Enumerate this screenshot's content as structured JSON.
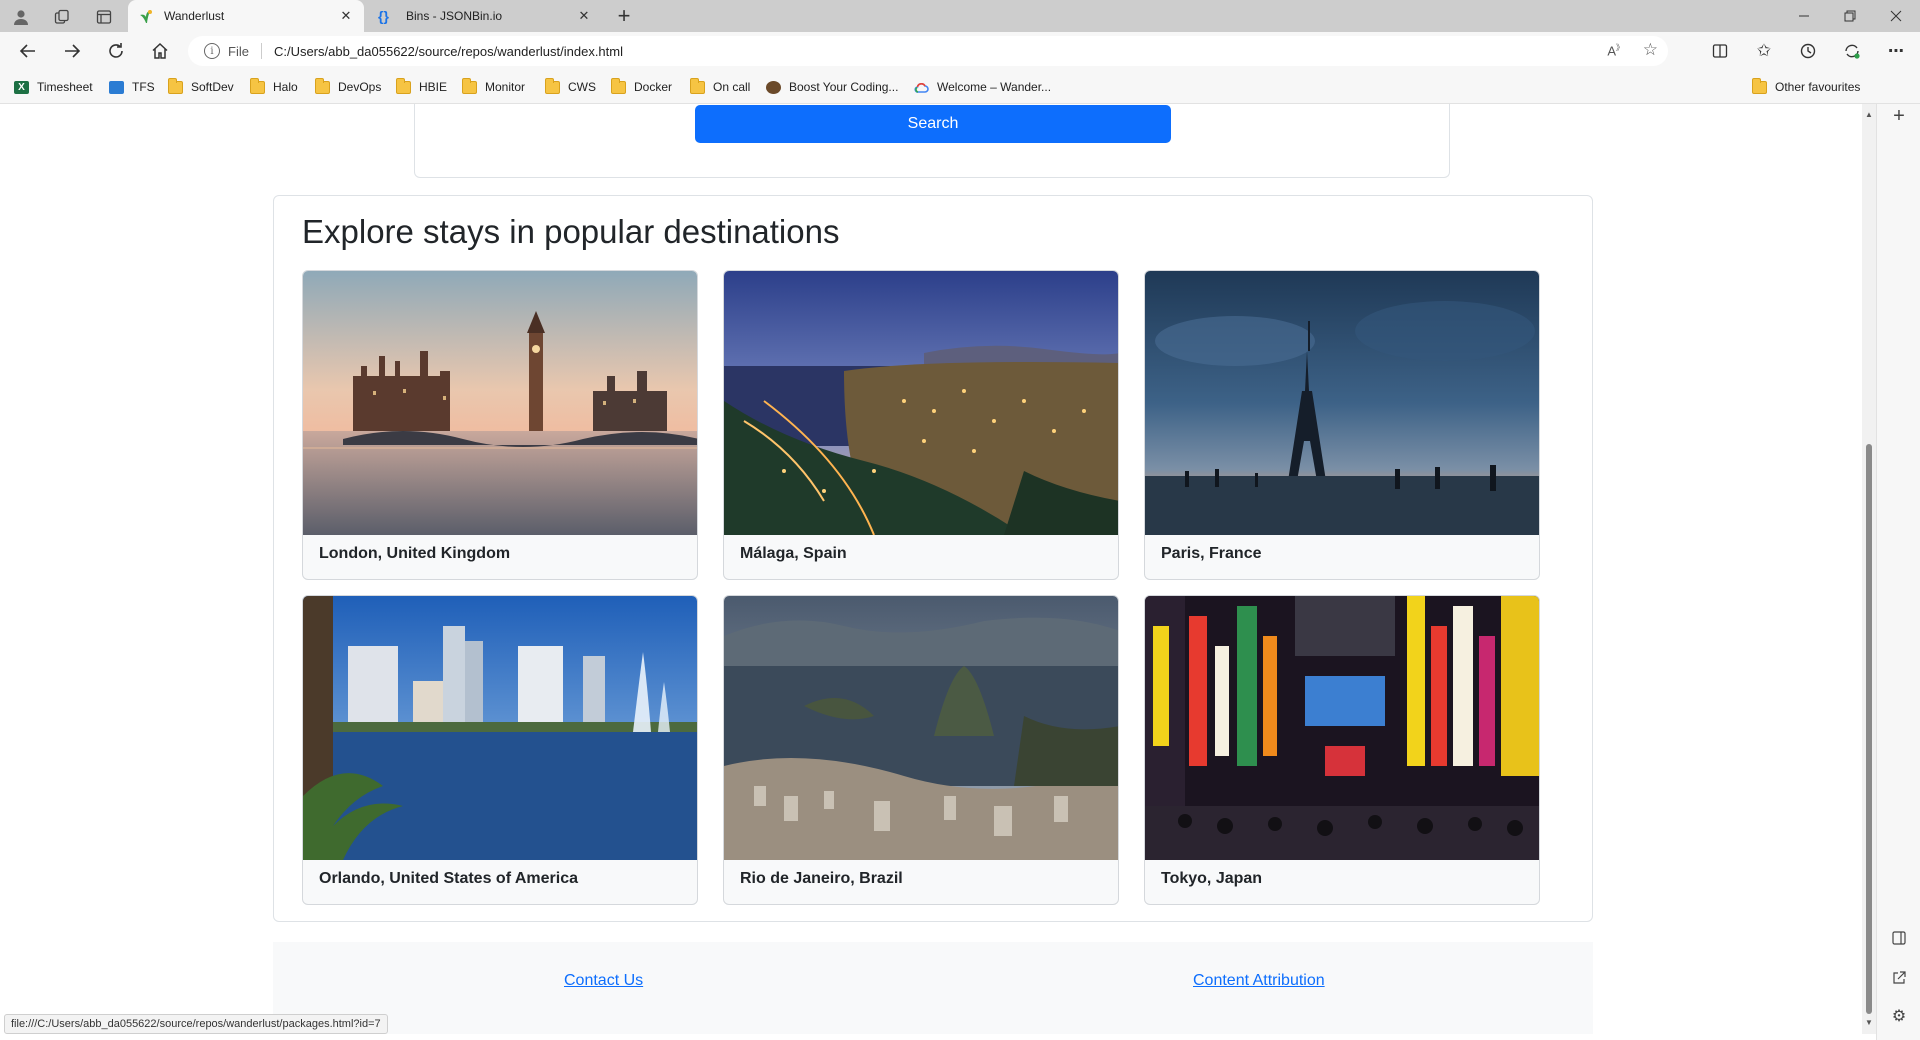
{
  "browser": {
    "tabs": [
      {
        "title": "Wanderlust",
        "active": true
      },
      {
        "title": "Bins - JSONBin.io",
        "active": false
      }
    ],
    "new_tab_label": "+",
    "address": {
      "scheme": "File",
      "url": "C:/Users/abb_da055622/source/repos/wanderlust/index.html"
    },
    "bookmarks": [
      {
        "label": "Timesheet",
        "icon": "excel-icon"
      },
      {
        "label": "TFS",
        "icon": "tfs-icon"
      },
      {
        "label": "SoftDev",
        "icon": "folder-icon"
      },
      {
        "label": "Halo",
        "icon": "folder-icon"
      },
      {
        "label": "DevOps",
        "icon": "folder-icon"
      },
      {
        "label": "HBIE",
        "icon": "folder-icon"
      },
      {
        "label": "Monitor",
        "icon": "folder-icon"
      },
      {
        "label": "CWS",
        "icon": "folder-icon"
      },
      {
        "label": "Docker",
        "icon": "folder-icon"
      },
      {
        "label": "On call",
        "icon": "folder-icon"
      },
      {
        "label": "Boost Your Coding...",
        "icon": "site-icon"
      },
      {
        "label": "Welcome – Wander...",
        "icon": "google-cloud-icon"
      }
    ],
    "other_favourites": "Other favourites",
    "status_url": "file:///C:/Users/abb_da055622/source/repos/wanderlust/packages.html?id=7"
  },
  "page": {
    "search_button": "Search",
    "destinations_title": "Explore stays in popular destinations",
    "destinations": [
      {
        "name": "London, United Kingdom",
        "image": "london-photo"
      },
      {
        "name": "Málaga, Spain",
        "image": "malaga-photo"
      },
      {
        "name": "Paris, France",
        "image": "paris-photo"
      },
      {
        "name": "Orlando, United States of America",
        "image": "orlando-photo"
      },
      {
        "name": "Rio de Janeiro, Brazil",
        "image": "rio-photo"
      },
      {
        "name": "Tokyo, Japan",
        "image": "tokyo-photo"
      }
    ],
    "footer": {
      "contact": "Contact Us",
      "attribution": "Content Attribution"
    }
  },
  "colors": {
    "accent": "#0d6efd",
    "chrome": "#cdcdcd",
    "toolbar": "#f7f7f7"
  }
}
